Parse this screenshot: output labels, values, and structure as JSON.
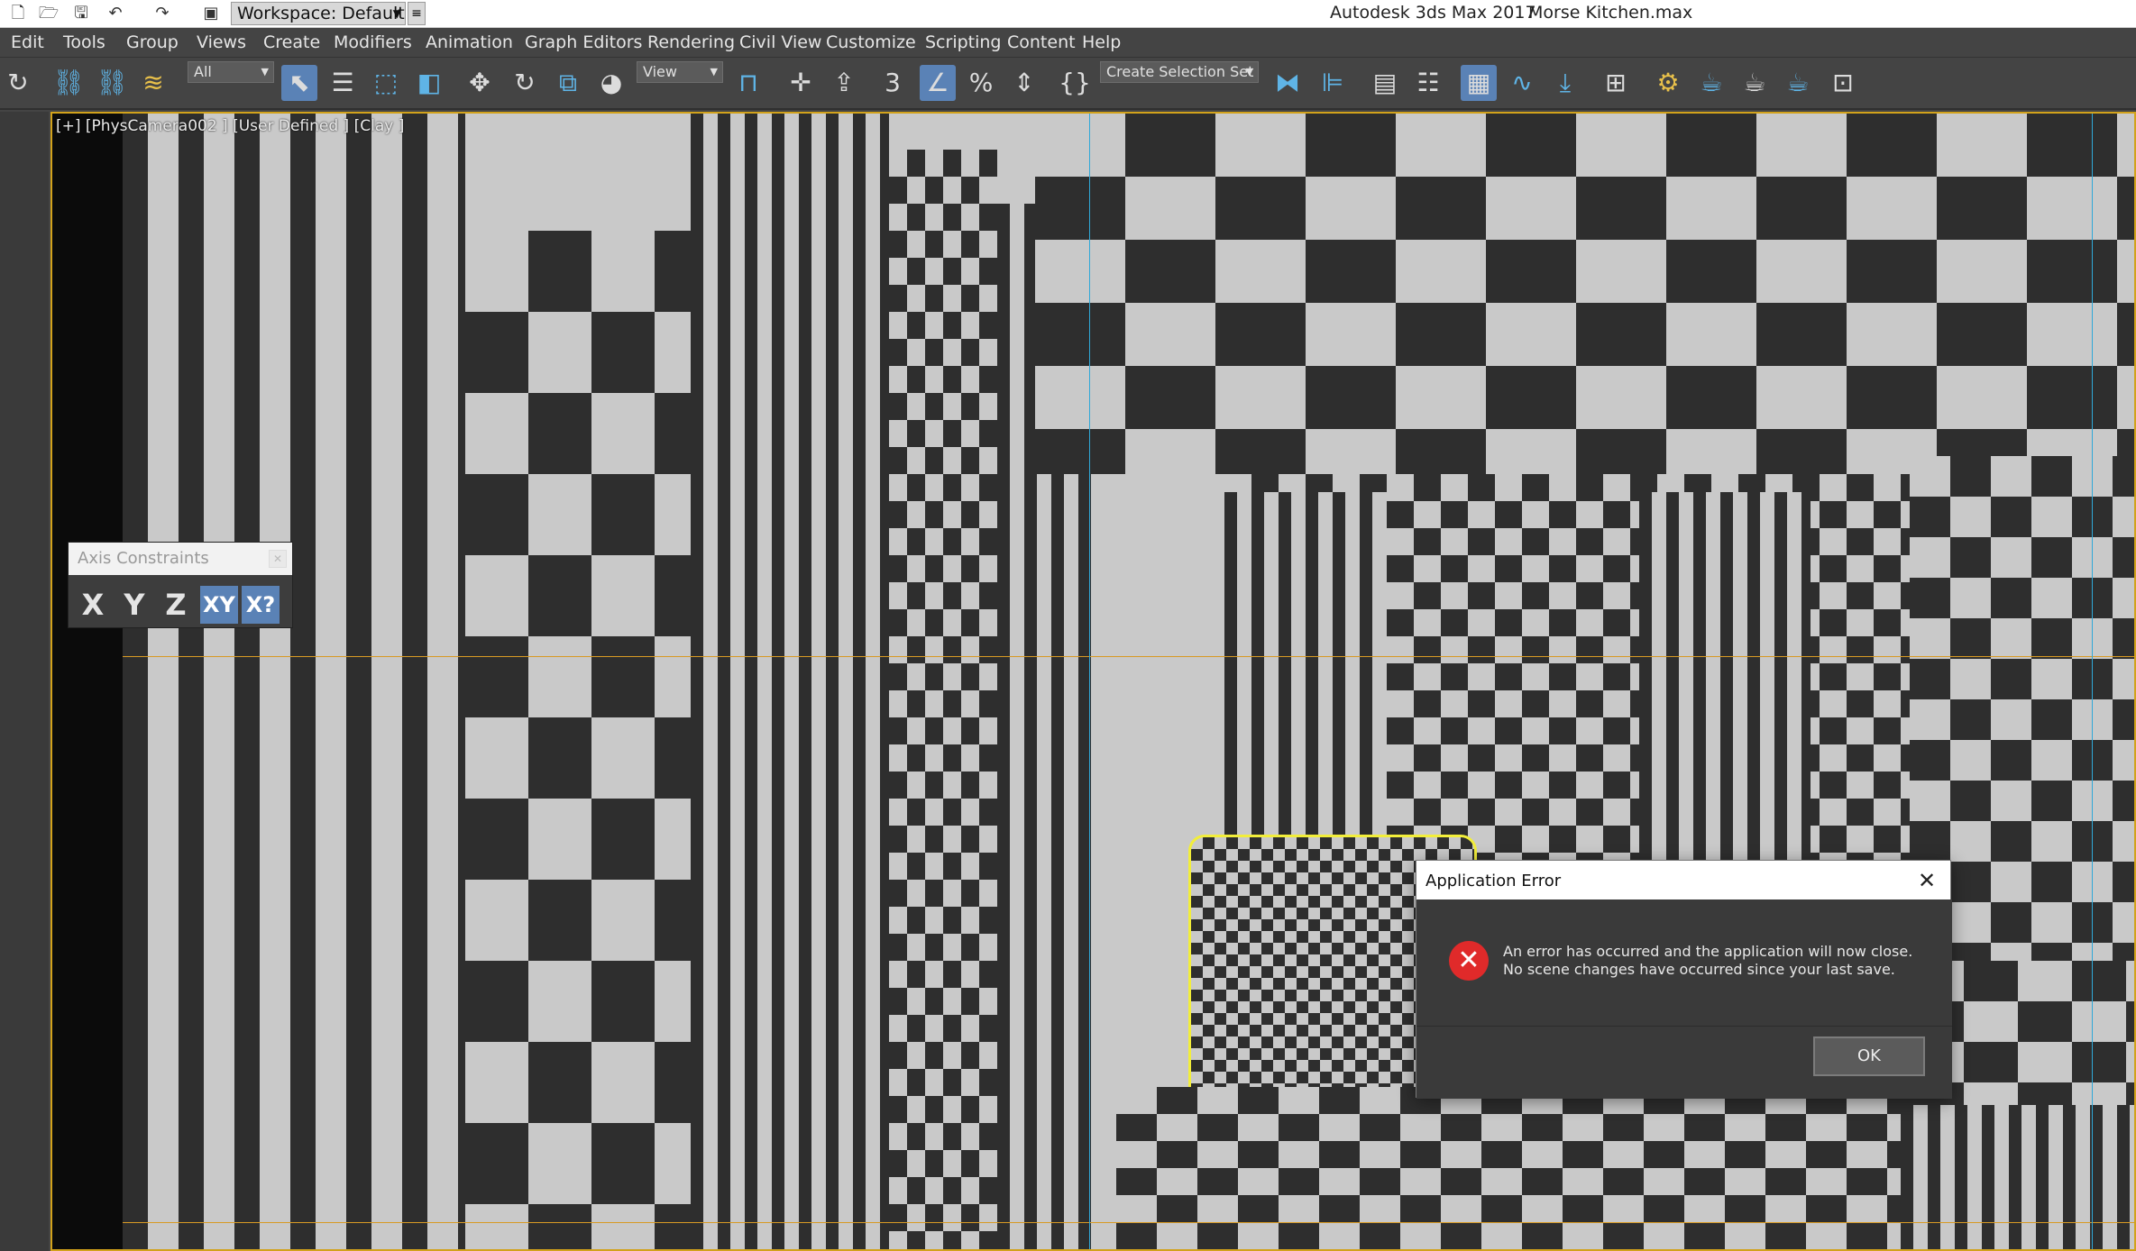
{
  "window": {
    "app_title": "Autodesk 3ds Max 2017",
    "file_title": "Morse Kitchen.max",
    "workspace_label": "Workspace: Default"
  },
  "menu": [
    "Edit",
    "Tools",
    "Group",
    "Views",
    "Create",
    "Modifiers",
    "Animation",
    "Graph Editors",
    "Rendering",
    "Civil View",
    "Customize",
    "Scripting",
    "Content",
    "Help"
  ],
  "toolbar": {
    "selection_filter": "All",
    "ref_coord": "View",
    "named_selection": "Create Selection Set"
  },
  "viewport": {
    "label": "[+] [PhysCamera002 ] [User Defined ] [Clay ]"
  },
  "axis_constraints": {
    "title": "Axis Constraints",
    "buttons": [
      "X",
      "Y",
      "Z",
      "XY",
      "X?"
    ]
  },
  "dialog": {
    "title": "Application Error",
    "line1": "An error has occurred and the application will now close.",
    "line2": "No scene changes have occurred since your last save.",
    "ok_label": "OK"
  },
  "colors": {
    "accent_blue": "#5a82b6",
    "error_red": "#e02a2a",
    "viewport_border": "#d2a21b"
  }
}
